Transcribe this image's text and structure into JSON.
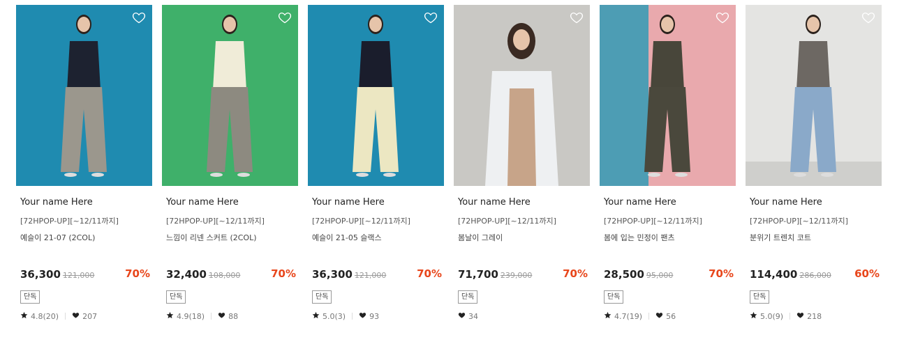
{
  "colors": {
    "discount": "#e8461b"
  },
  "products": [
    {
      "brand": "Your name Here",
      "promo": "[72HPOP-UP][~12/11까지]",
      "name": "예슬이 21-07 (2COL)",
      "price": "36,300",
      "original_price": "121,000",
      "discount": "70%",
      "badge": "단독",
      "rating": "4.8(20)",
      "likes": "207",
      "bg": "#1f8bb0",
      "top": "#1d2230",
      "bottom": "#9b978d"
    },
    {
      "brand": "Your name Here",
      "promo": "[72HPOP-UP][~12/11까지]",
      "name": "느낌이 리넨 스커트 (2COL)",
      "price": "32,400",
      "original_price": "108,000",
      "discount": "70%",
      "badge": "단독",
      "rating": "4.9(18)",
      "likes": "88",
      "bg": "#3fb06a",
      "top": "#f0ecd8",
      "bottom": "#8d8a80"
    },
    {
      "brand": "Your name Here",
      "promo": "[72HPOP-UP][~12/11까지]",
      "name": "예슬이 21-05 슬랙스",
      "price": "36,300",
      "original_price": "121,000",
      "discount": "70%",
      "badge": "단독",
      "rating": "5.0(3)",
      "likes": "93",
      "bg": "#1f8bb0",
      "top": "#1a1d2c",
      "bottom": "#ece7c2"
    },
    {
      "brand": "Your name Here",
      "promo": "[72HPOP-UP][~12/11까지]",
      "name": "봄날이 그레이",
      "price": "71,700",
      "original_price": "239,000",
      "discount": "70%",
      "badge": "단독",
      "rating": "",
      "likes": "34",
      "bg": "#c9c8c4",
      "top": "#eef0f2",
      "bottom": "#c7a489"
    },
    {
      "brand": "Your name Here",
      "promo": "[72HPOP-UP][~12/11까지]",
      "name": "봄에 입는 민정이 팬츠",
      "price": "28,500",
      "original_price": "95,000",
      "discount": "70%",
      "badge": "단독",
      "rating": "4.7(19)",
      "likes": "56",
      "bg": "#e9a9ad",
      "top": "#48463a",
      "bottom": "#4a483c"
    },
    {
      "brand": "Your name Here",
      "promo": "[72HPOP-UP][~12/11까지]",
      "name": "분위기 트렌치 코트",
      "price": "114,400",
      "original_price": "286,000",
      "discount": "60%",
      "badge": "단독",
      "rating": "5.0(9)",
      "likes": "218",
      "bg": "#e4e4e2",
      "top": "#6d6863",
      "bottom": "#8aa9c9"
    }
  ]
}
